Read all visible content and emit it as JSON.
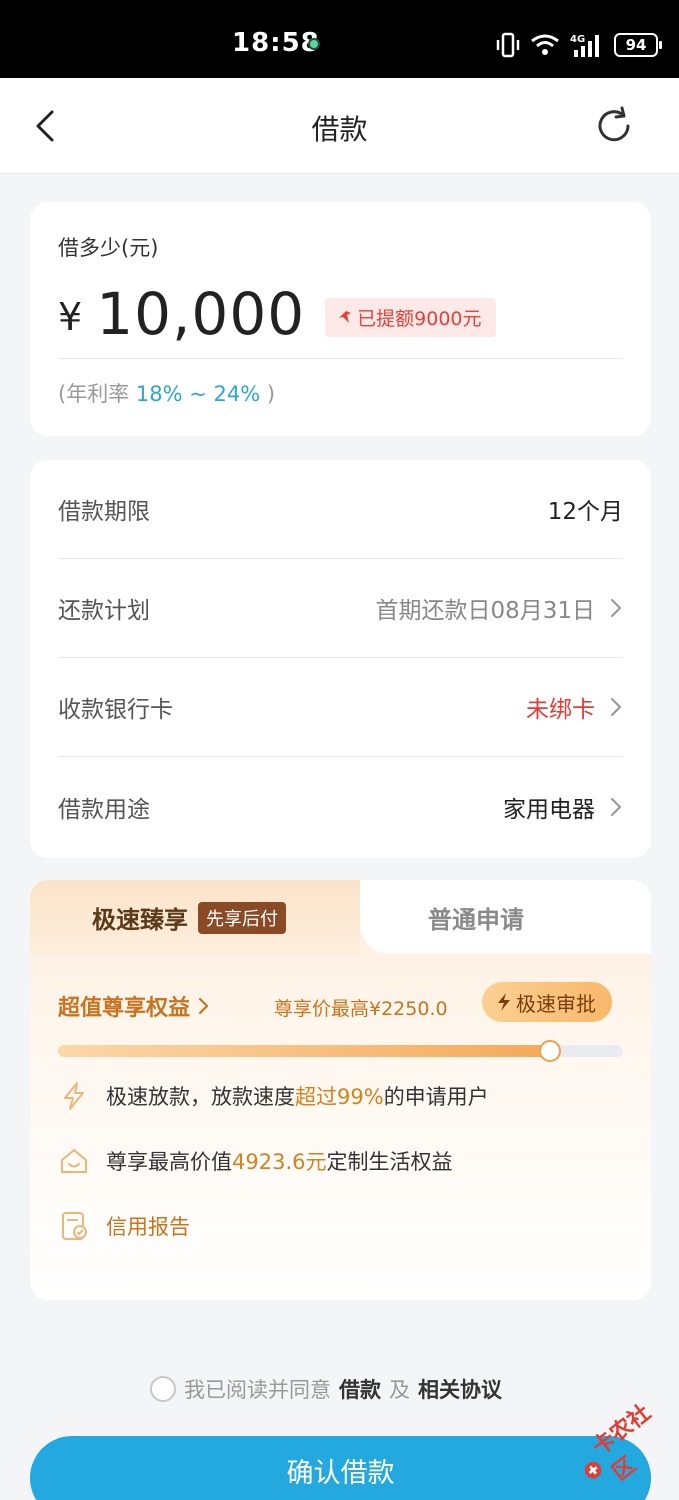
{
  "status_bar": {
    "time": "18:58",
    "battery": "94",
    "network": "4G"
  },
  "nav": {
    "title": "借款"
  },
  "amount": {
    "label": "借多少(元)",
    "currency": "¥",
    "value": "10,000",
    "raise_badge": "已提额9000元",
    "rate_prefix": "(年利率 ",
    "rate_value": "18% ~ 24%",
    "rate_suffix": " )"
  },
  "info": {
    "rows": [
      {
        "label": "借款期限",
        "value": "12个月"
      },
      {
        "label": "还款计划",
        "value": "首期还款日08月31日"
      },
      {
        "label": "收款银行卡",
        "value": "未绑卡"
      },
      {
        "label": "借款用途",
        "value": "家用电器"
      }
    ]
  },
  "plan": {
    "tab_fast": "极速臻享",
    "tab_fast_badge": "先享后付",
    "tab_normal": "普通申请",
    "benefit_title": "超值尊享权益",
    "benefit_price": "尊享价最高¥2250.0",
    "fast_approve": "极速审批",
    "progress": 0.87,
    "features": [
      {
        "icon": "lightning-icon",
        "text_a": "极速放款，放款速度",
        "highlight": "超过99%",
        "text_b": "的申请用户"
      },
      {
        "icon": "home-icon",
        "text_a": "尊享最高价值",
        "highlight": "4923.6元",
        "text_b": "定制生活权益"
      },
      {
        "icon": "report-icon",
        "link": "信用报告"
      }
    ]
  },
  "agreement": {
    "prefix": "我已阅读并同意",
    "link_a": "借款",
    "mid": "及",
    "link_b": "相关协议"
  },
  "confirm_button": "确认借款",
  "watermark": "卡农社区",
  "colors": {
    "primary": "#24a8e0",
    "alert": "#e23d35",
    "gold": "#c8741f"
  }
}
